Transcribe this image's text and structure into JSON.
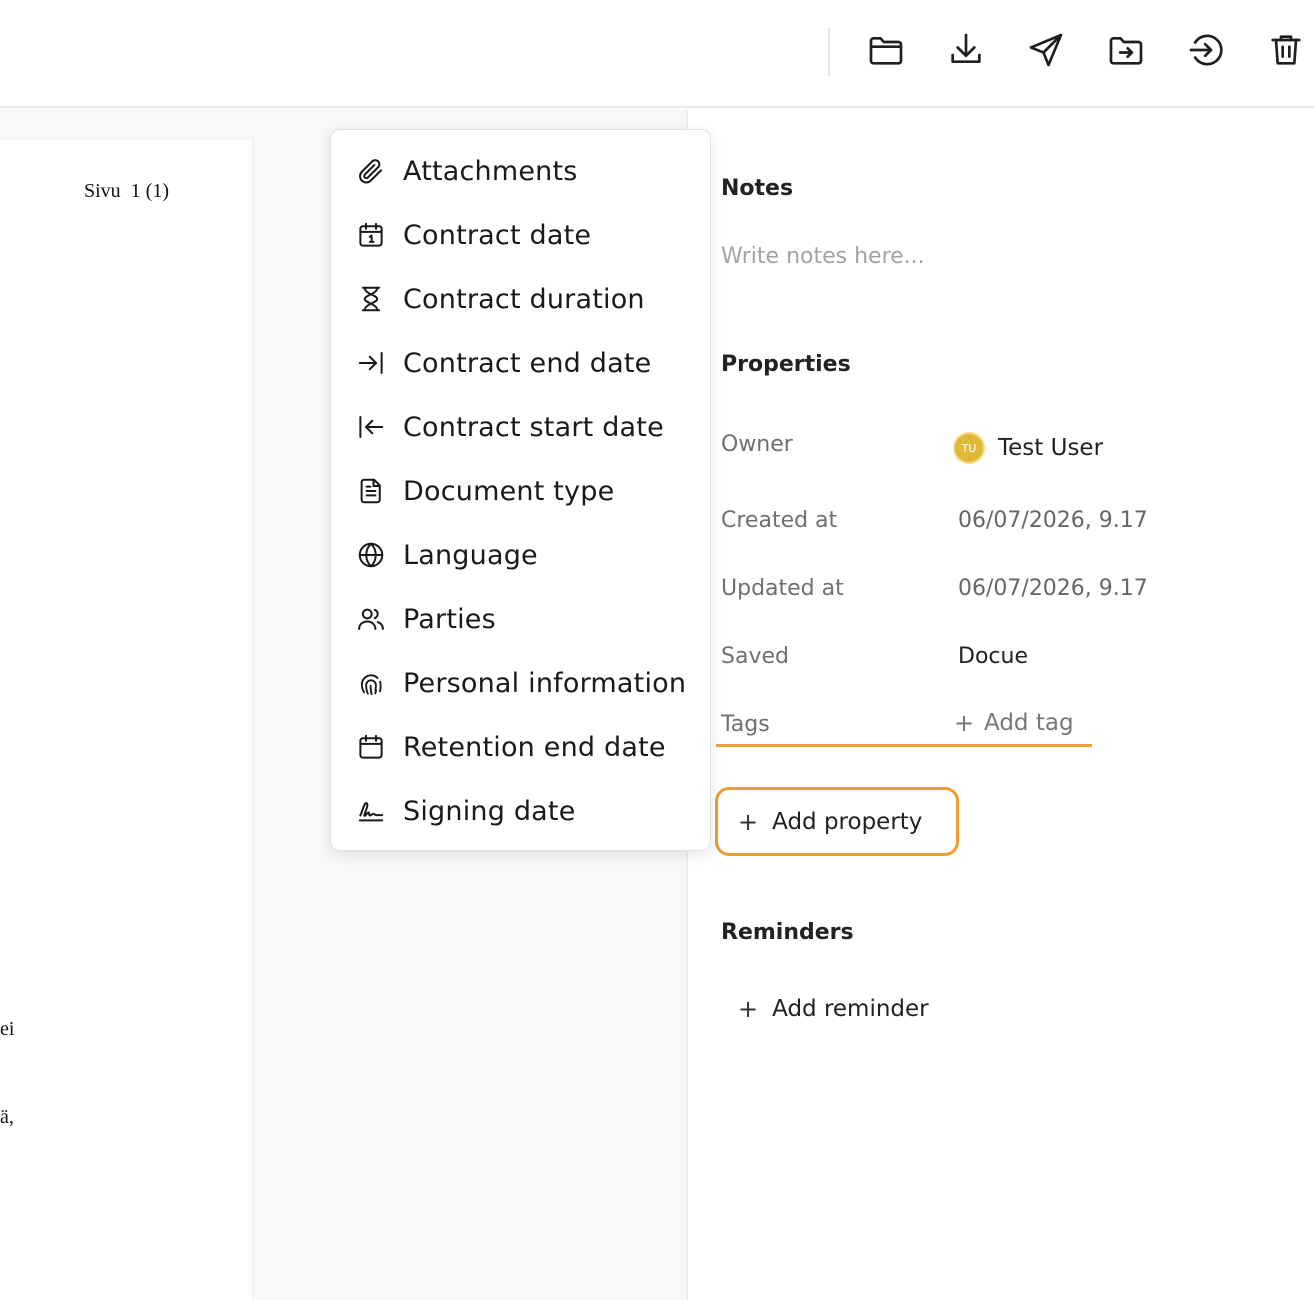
{
  "toolbar": {
    "buttons": [
      {
        "name": "folder-icon"
      },
      {
        "name": "download-icon"
      },
      {
        "name": "send-icon"
      },
      {
        "name": "move-to-folder-icon"
      },
      {
        "name": "sign-in-icon"
      },
      {
        "name": "trash-icon"
      }
    ]
  },
  "document": {
    "header": "Sivu  1 (1)",
    "fragment_1": "ei",
    "fragment_2": "ä,"
  },
  "menu": {
    "items": [
      {
        "label": "Attachments",
        "icon": "paperclip-icon"
      },
      {
        "label": "Contract date",
        "icon": "calendar-date-icon"
      },
      {
        "label": "Contract duration",
        "icon": "hourglass-icon"
      },
      {
        "label": "Contract end date",
        "icon": "arrow-right-to-line-icon"
      },
      {
        "label": "Contract start date",
        "icon": "arrow-left-from-line-icon"
      },
      {
        "label": "Document type",
        "icon": "file-text-icon"
      },
      {
        "label": "Language",
        "icon": "globe-icon"
      },
      {
        "label": "Parties",
        "icon": "users-icon"
      },
      {
        "label": "Personal information",
        "icon": "fingerprint-icon"
      },
      {
        "label": "Retention end date",
        "icon": "calendar-icon"
      },
      {
        "label": "Signing date",
        "icon": "signature-icon"
      }
    ]
  },
  "panel": {
    "notes": {
      "title": "Notes",
      "placeholder": "Write notes here..."
    },
    "properties": {
      "title": "Properties",
      "owner_label": "Owner",
      "owner_initials": "TU",
      "owner_name": "Test User",
      "created_label": "Created at",
      "created_value": "06/07/2026, 9.17",
      "updated_label": "Updated at",
      "updated_value": "06/07/2026, 9.17",
      "saved_label": "Saved",
      "saved_value": "Docue",
      "tags_label": "Tags",
      "add_tag_label": "Add tag",
      "add_property_label": "Add property"
    },
    "reminders": {
      "title": "Reminders",
      "add_reminder_label": "Add reminder"
    }
  },
  "colors": {
    "accent": "#ec9d33",
    "avatar": "#e0b93a"
  }
}
